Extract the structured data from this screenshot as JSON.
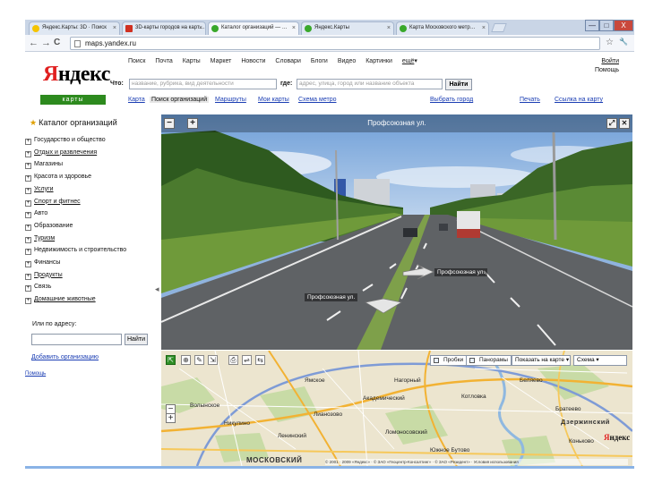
{
  "browser": {
    "tabs": [
      {
        "label": "Яндекс.Карты: 3D · Поиск",
        "icon": "yandex-favicon-icon"
      },
      {
        "label": "3D-карты городов на карт…",
        "icon": "yandex-e-favicon-icon"
      },
      {
        "label": "Каталог организаций — …",
        "icon": "yandex-maps-favicon-icon"
      },
      {
        "label": "Яндекс.Карты",
        "icon": "yandex-maps-favicon-icon"
      },
      {
        "label": "Карта Московского метр…",
        "icon": "yandex-maps-favicon-icon"
      }
    ],
    "url": "maps.yandex.ru",
    "tab_close": "×",
    "nav_back": "←",
    "nav_forward": "→",
    "nav_reload": "C",
    "bookmark_star": "☆",
    "wrench": "🔧",
    "win_min": "—",
    "win_max": "□",
    "win_close": "X"
  },
  "header": {
    "services": [
      "Поиск",
      "Почта",
      "Карты",
      "Маркет",
      "Новости",
      "Словари",
      "Блоги",
      "Видео",
      "Картинки"
    ],
    "more": "ещё",
    "more_arrow": "▾",
    "login": "Войти",
    "settings": "Помощь",
    "logo_first": "Я",
    "logo_rest": "ндекс",
    "badge": "карты",
    "what_label": "Что:",
    "what_placeholder": "название, рубрика, вид деятельности",
    "where_label": "где:",
    "where_placeholder": "адрес, улица, город или название объекта",
    "find_button": "Найти",
    "subnav": [
      {
        "label": "Карта",
        "selected": false
      },
      {
        "label": "Поиск организаций",
        "selected": true
      },
      {
        "label": "Маршруты",
        "selected": false
      },
      {
        "label": "Мои карты",
        "selected": false
      },
      {
        "label": "Схема метро",
        "selected": false
      }
    ],
    "choose_city": "Выбрать город",
    "print": "Печать",
    "send_link": "Ссылка на карту"
  },
  "catalog": {
    "title": "Каталог организаций",
    "star": "★",
    "items": [
      {
        "label": "Государство и общество",
        "underline": false
      },
      {
        "label": "Отдых и развлечения",
        "underline": true
      },
      {
        "label": "Магазины",
        "underline": false
      },
      {
        "label": "Красота и здоровье",
        "underline": false
      },
      {
        "label": "Услуги",
        "underline": true
      },
      {
        "label": "Спорт и фитнес",
        "underline": true
      },
      {
        "label": "Авто",
        "underline": false
      },
      {
        "label": "Образование",
        "underline": false
      },
      {
        "label": "Туризм",
        "underline": true
      },
      {
        "label": "Недвижимость и строительство",
        "underline": false
      },
      {
        "label": "Финансы",
        "underline": false
      },
      {
        "label": "Продукты",
        "underline": true
      },
      {
        "label": "Связь",
        "underline": false
      },
      {
        "label": "Домашние животные",
        "underline": true
      }
    ],
    "expand_symbol": "+",
    "address_label": "Или по адресу:",
    "address_value": "",
    "address_button": "Найти",
    "add_org": "Добавить организацию",
    "help": "Помощь",
    "collapse_arrow": "◂"
  },
  "panorama": {
    "title": "Профсоюзная ул.",
    "zoom_out": "−",
    "zoom_in": "+",
    "close": "✕",
    "expand": "⤢",
    "label_ahead": "Профсоюзная ул.",
    "label_back": "Профсоюзная ул."
  },
  "map": {
    "layers": [
      {
        "label": "Пробки"
      },
      {
        "label": "Панорамы"
      }
    ],
    "select_map": "Показать на карте",
    "select_type": "Схема",
    "dropdown_arrow": "▾",
    "zoom_in": "+",
    "zoom_out": "−",
    "tools": [
      "⇱",
      "⊕",
      "✎",
      "⇲",
      "⎙",
      "⇌",
      "⇆"
    ],
    "places": [
      "Волынское",
      "Ямское",
      "Никулино",
      "Лианозово",
      "Ленинский",
      "Академический",
      "Нагорный",
      "Ломоносовский",
      "Котловка",
      "Дзержинский",
      "Братеево",
      "Беляево",
      "Коньково",
      "Южное Бутово"
    ],
    "district_big": "МОСКОВСКИЙ",
    "district_right": "Дзержинский",
    "logo_first": "Я",
    "logo_rest": "ндекс",
    "copyright": "© 2001 · 2009 «Яндекс» · © ЗАО «Геоцентр-Консалтинг» · © ЗАО «Резидент» · Условия использования"
  },
  "colors": {
    "brand_red": "#e02020",
    "brand_green": "#2d8a1e",
    "link_blue": "#1a3db3"
  }
}
